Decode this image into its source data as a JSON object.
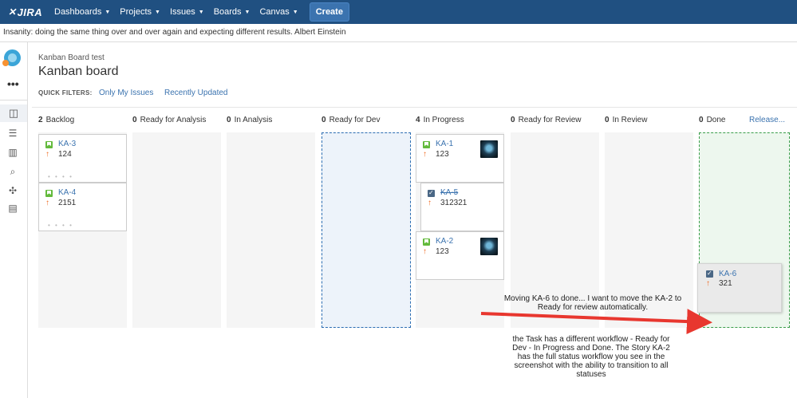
{
  "topbar": {
    "logo_text": "JIRA",
    "nav": [
      {
        "label": "Dashboards"
      },
      {
        "label": "Projects"
      },
      {
        "label": "Issues"
      },
      {
        "label": "Boards"
      },
      {
        "label": "Canvas"
      }
    ],
    "create_label": "Create",
    "bg_color": "#205081"
  },
  "quote_bar": {
    "text": "Insanity: doing the same thing over and over again and expecting different results. Albert Einstein"
  },
  "sidebar": {
    "more_label": "•••",
    "icons": [
      "board-icon",
      "backlog-icon",
      "reports-icon",
      "issues-icon",
      "components-icon",
      "list-icon"
    ]
  },
  "board": {
    "project_name": "Kanban Board test",
    "title": "Kanban board",
    "quick_filters_label": "QUICK FILTERS:",
    "quick_filters": [
      "Only My Issues",
      "Recently Updated"
    ],
    "release_label": "Release..."
  },
  "columns": [
    {
      "count": "2",
      "name": "Backlog"
    },
    {
      "count": "0",
      "name": "Ready for Analysis"
    },
    {
      "count": "0",
      "name": "In Analysis"
    },
    {
      "count": "0",
      "name": "Ready for Dev"
    },
    {
      "count": "4",
      "name": "In Progress"
    },
    {
      "count": "0",
      "name": "Ready for Review"
    },
    {
      "count": "0",
      "name": "In Review"
    },
    {
      "count": "0",
      "name": "Done"
    }
  ],
  "cards": [
    {
      "key": "KA-3",
      "summary": "124",
      "type": "story",
      "priority": "↑"
    },
    {
      "key": "KA-4",
      "summary": "2151",
      "type": "story",
      "priority": "↑"
    },
    {
      "key": "KA-1",
      "summary": "123",
      "type": "story",
      "priority": "↑"
    },
    {
      "key": "KA-5",
      "summary": "312321",
      "type": "task",
      "priority": "↑"
    },
    {
      "key": "KA-2",
      "summary": "123",
      "type": "story",
      "priority": "↑"
    }
  ],
  "dragged_card": {
    "key": "KA-6",
    "summary": "321",
    "type": "task",
    "priority": "↑"
  },
  "annotations": {
    "note1": "Moving KA-6 to done... I want to move the KA-2 to Ready for review automatically.",
    "note2": "the Task has a different workflow - Ready for Dev - In Progress and Done. The Story KA-2 has the full status workflow you see in the screenshot with the ability to transition to all statuses",
    "arrow_color": "#e8372f"
  }
}
